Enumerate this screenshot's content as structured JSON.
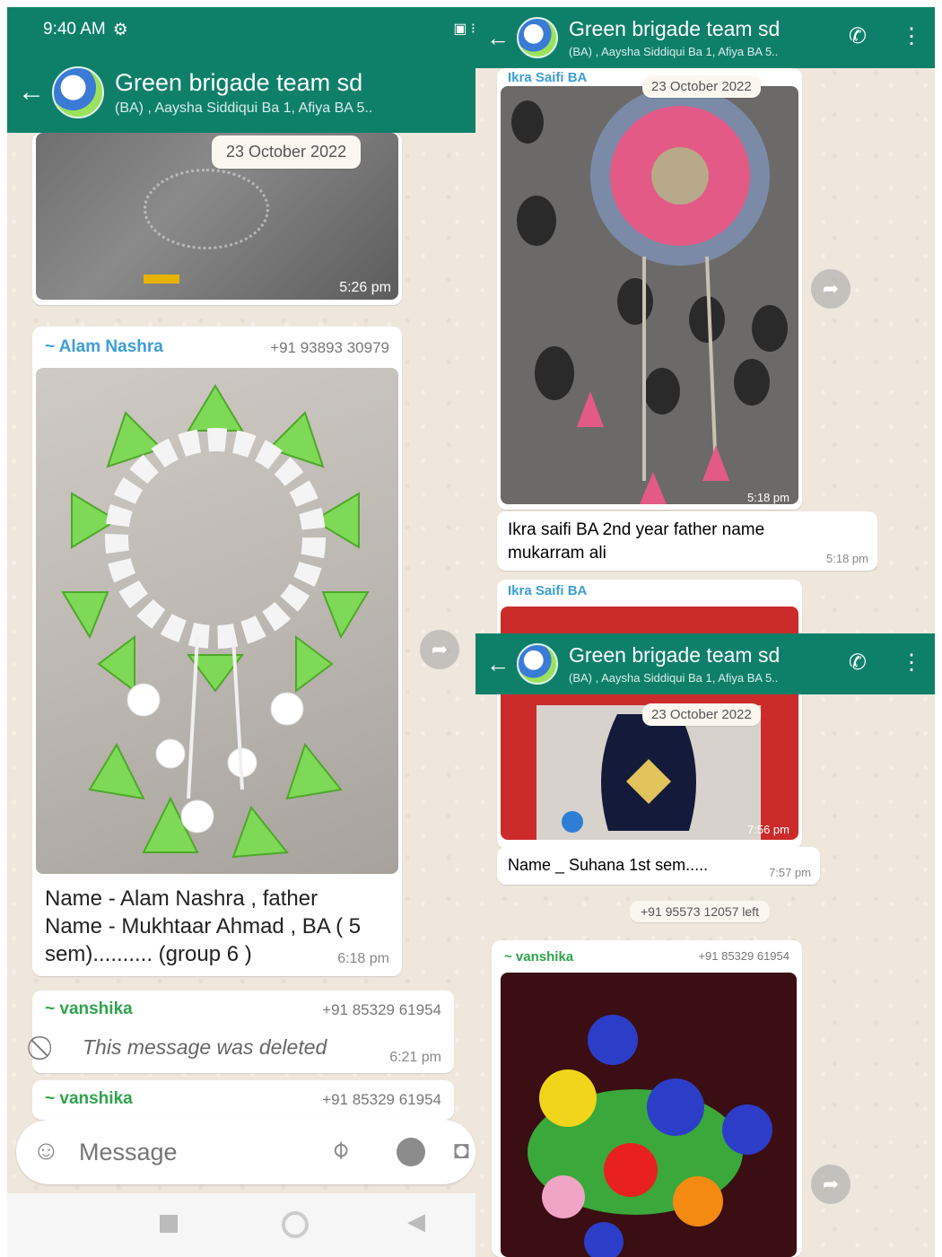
{
  "status_bar": {
    "time": "9:40 AM"
  },
  "chat": {
    "title": "Green brigade team sd",
    "subtitle": "(BA) , Aaysha Siddiqui Ba 1, Afiya BA 5.."
  },
  "left": {
    "date_chip": "23 October 2022",
    "image1_time": "5:26 pm",
    "msg_alam": {
      "sender": "~ Alam Nashra",
      "phone": "+91 93893 30979",
      "caption_line1": "Name - Alam Nashra , father",
      "caption_line2": "Name - Mukhtaar Ahmad , BA ( 5",
      "caption_line3": "sem).......... (group 6 )",
      "time": "6:18 pm"
    },
    "msg_deleted": {
      "sender": "~ vanshika",
      "phone": "+91 85329 61954",
      "text": "This message was deleted",
      "time": "6:21 pm"
    },
    "msg_vanshika2": {
      "sender": "~ vanshika",
      "phone": "+91 85329 61954"
    },
    "composer": {
      "placeholder": "Message"
    }
  },
  "right": {
    "msg_ikra": {
      "sender": "Ikra Saifi BA",
      "date_chip": "23 October 2022",
      "image_time": "5:18 pm",
      "caption_line1": "Ikra saifi BA 2nd year father name",
      "caption_line2": "mukarram ali",
      "caption_time": "5:18 pm"
    },
    "msg_ikra2": {
      "sender": "Ikra Saifi BA",
      "date_chip": "23 October 2022",
      "image_time": "7:56 pm",
      "caption": "Name _ Suhana 1st sem.....",
      "caption_time": "7:57 pm"
    },
    "system_left": "+91 95573 12057 left",
    "msg_vanshika": {
      "sender": "~ vanshika",
      "phone": "+91 85329 61954"
    }
  },
  "colors": {
    "header_green": "#0e806a",
    "sender_green": "#2fa34d",
    "sender_blue": "#3c9ed6"
  }
}
